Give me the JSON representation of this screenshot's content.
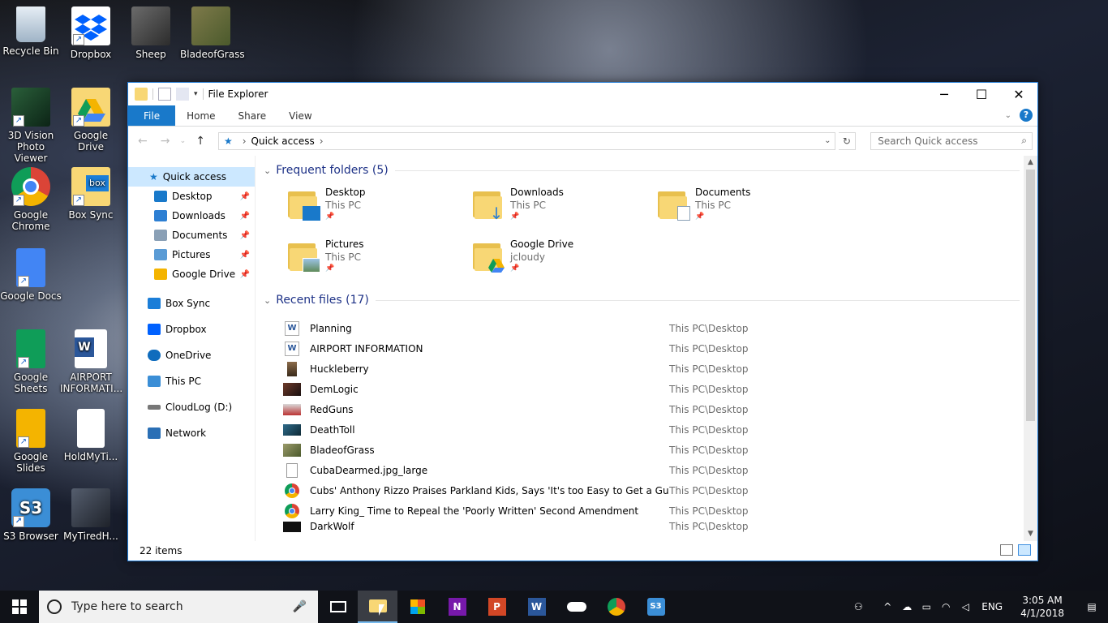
{
  "desktop": {
    "icons": [
      {
        "label": "Recycle Bin"
      },
      {
        "label": "Dropbox"
      },
      {
        "label": "Sheep"
      },
      {
        "label": "BladeofGrass"
      },
      {
        "label": "3D Vision Photo Viewer"
      },
      {
        "label": "Google Drive"
      },
      {
        "label": "Google Chrome"
      },
      {
        "label": "Box Sync"
      },
      {
        "label": "Google Docs"
      },
      {
        "label": "Google Sheets"
      },
      {
        "label": "AIRPORT INFORMATI..."
      },
      {
        "label": "Google Slides"
      },
      {
        "label": "HoldMyTi..."
      },
      {
        "label": "S3 Browser"
      },
      {
        "label": "MyTiredH..."
      }
    ]
  },
  "window": {
    "title": "File Explorer",
    "controls": {
      "minimize": "─",
      "maximize": "☐",
      "close": "✕"
    }
  },
  "ribbon": {
    "tabs": [
      {
        "label": "File"
      },
      {
        "label": "Home"
      },
      {
        "label": "Share"
      },
      {
        "label": "View"
      }
    ],
    "help": "?"
  },
  "address": {
    "location": "Quick access",
    "search_placeholder": "Search Quick access"
  },
  "nav": {
    "quick_access": "Quick access",
    "pinned": [
      {
        "label": "Desktop",
        "color": "#1979ca"
      },
      {
        "label": "Downloads",
        "color": "#2d7fd3"
      },
      {
        "label": "Documents",
        "color": "#8aa0b6"
      },
      {
        "label": "Pictures",
        "color": "#5a9bd5"
      },
      {
        "label": "Google Drive",
        "color": "#f4b400"
      }
    ],
    "roots": [
      {
        "label": "Box Sync",
        "color": "#1b7ed8"
      },
      {
        "label": "Dropbox",
        "color": "#0061fe"
      },
      {
        "label": "OneDrive",
        "color": "#0f6cbd"
      },
      {
        "label": "This PC",
        "color": "#3b8ed6"
      },
      {
        "label": "CloudLog (D:)",
        "color": "#777777"
      },
      {
        "label": "Network",
        "color": "#2a6fb5"
      }
    ]
  },
  "frequent": {
    "header": "Frequent folders (5)",
    "folders": [
      {
        "name": "Desktop",
        "sub": "This PC"
      },
      {
        "name": "Downloads",
        "sub": "This PC"
      },
      {
        "name": "Documents",
        "sub": "This PC"
      },
      {
        "name": "Pictures",
        "sub": "This PC"
      },
      {
        "name": "Google Drive",
        "sub": "jcloudy"
      }
    ]
  },
  "recent": {
    "header": "Recent files (17)",
    "files": [
      {
        "name": "Planning",
        "location": "This PC\\Desktop",
        "icon": "word-icon"
      },
      {
        "name": "AIRPORT INFORMATION",
        "location": "This PC\\Desktop",
        "icon": "word-icon"
      },
      {
        "name": "Huckleberry",
        "location": "This PC\\Desktop",
        "icon": "image-icon"
      },
      {
        "name": "DemLogic",
        "location": "This PC\\Desktop",
        "icon": "image-icon"
      },
      {
        "name": "RedGuns",
        "location": "This PC\\Desktop",
        "icon": "image-icon"
      },
      {
        "name": "DeathToll",
        "location": "This PC\\Desktop",
        "icon": "image-icon"
      },
      {
        "name": "BladeofGrass",
        "location": "This PC\\Desktop",
        "icon": "image-icon"
      },
      {
        "name": "CubaDearmed.jpg_large",
        "location": "This PC\\Desktop",
        "icon": "blank-file-icon"
      },
      {
        "name": "Cubs' Anthony Rizzo Praises Parkland Kids, Says 'It's too Easy to Get a Gun'",
        "location": "This PC\\Desktop",
        "icon": "chrome-icon"
      },
      {
        "name": "Larry King_ Time to Repeal the 'Poorly Written' Second Amendment",
        "location": "This PC\\Desktop",
        "icon": "chrome-icon"
      },
      {
        "name": "DarkWolf",
        "location": "This PC\\Desktop",
        "icon": "image-icon"
      }
    ]
  },
  "status": {
    "items": "22 items"
  },
  "taskbar": {
    "search_placeholder": "Type here to search",
    "language": "ENG",
    "time": "3:05 AM",
    "date": "4/1/2018"
  }
}
